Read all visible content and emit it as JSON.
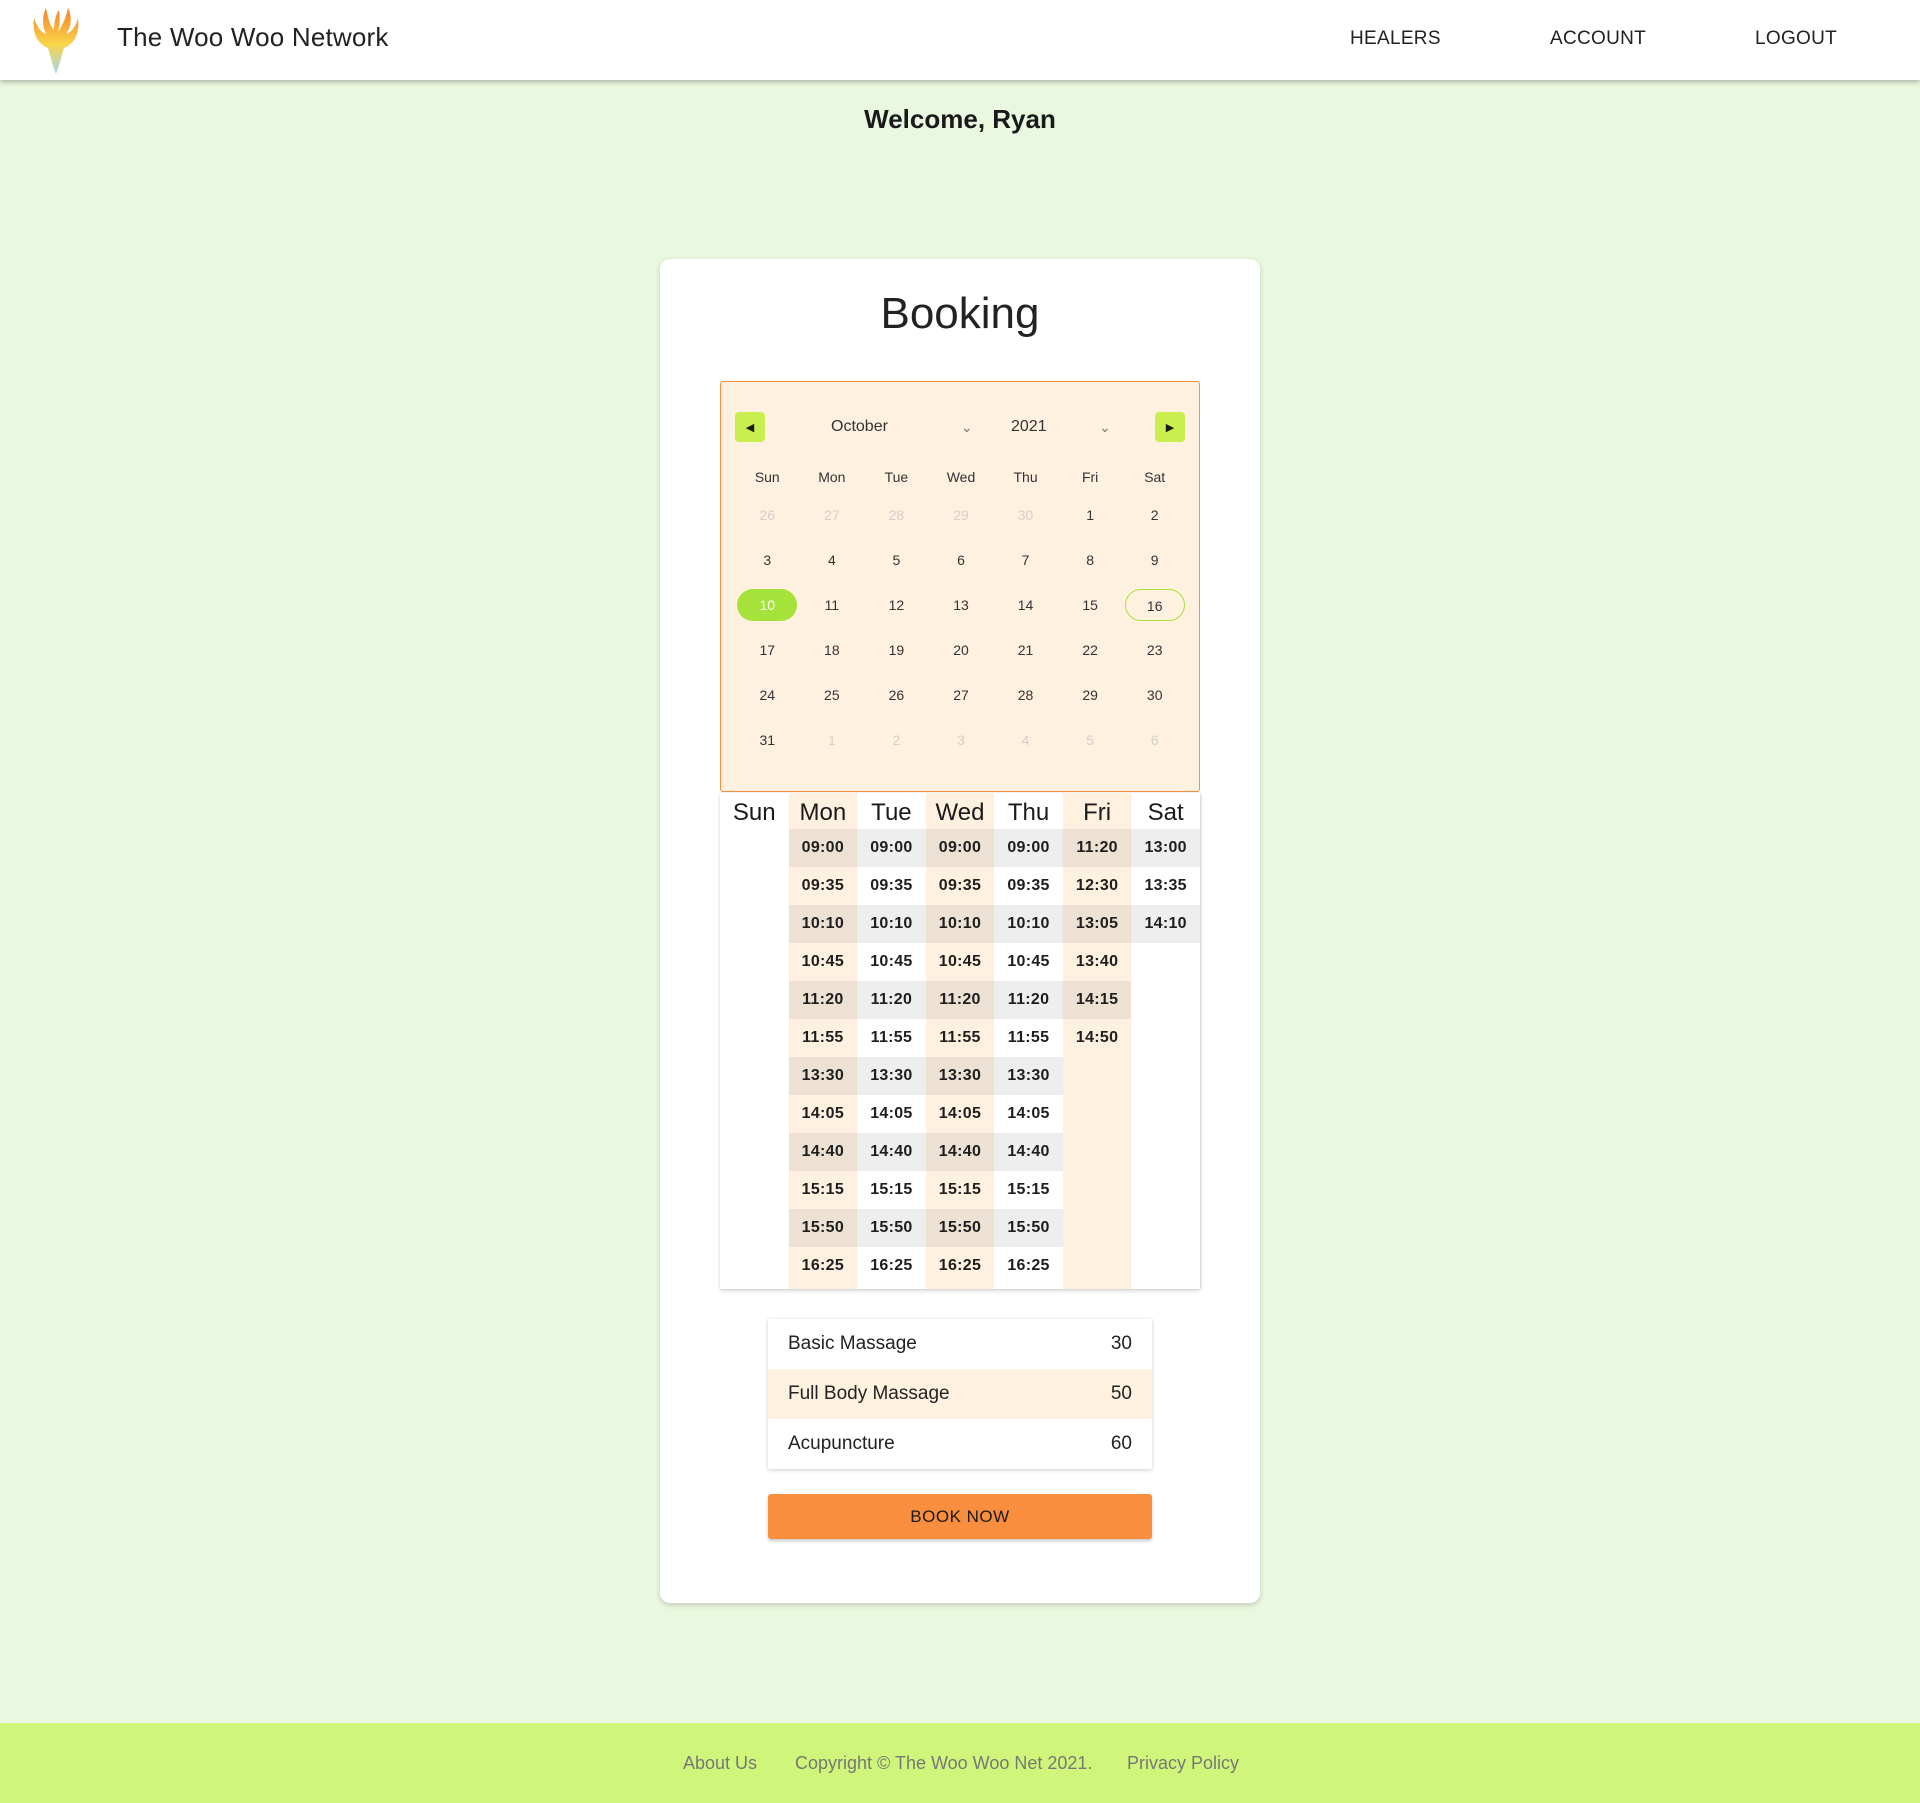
{
  "header": {
    "brand": "The Woo Woo Network",
    "nav": {
      "healers": "HEALERS",
      "account": "ACCOUNT",
      "logout": "LOGOUT"
    }
  },
  "welcome": "Welcome, Ryan",
  "booking": {
    "title": "Booking",
    "calendar": {
      "month": "October",
      "year": "2021",
      "weekdays": [
        "Sun",
        "Mon",
        "Tue",
        "Wed",
        "Thu",
        "Fri",
        "Sat"
      ],
      "selected_day": "10",
      "today_day": "16",
      "days": [
        "26",
        "27",
        "28",
        "29",
        "30",
        "1",
        "2",
        "3",
        "4",
        "5",
        "6",
        "7",
        "8",
        "9",
        "10",
        "11",
        "12",
        "13",
        "14",
        "15",
        "16",
        "17",
        "18",
        "19",
        "20",
        "21",
        "22",
        "23",
        "24",
        "25",
        "26",
        "27",
        "28",
        "29",
        "30",
        "31",
        "1",
        "2",
        "3",
        "4",
        "5",
        "6"
      ],
      "outside_month": [
        0,
        1,
        2,
        3,
        4,
        36,
        37,
        38,
        39,
        40,
        41
      ]
    },
    "schedule": [
      {
        "day": "Sun",
        "slots": []
      },
      {
        "day": "Mon",
        "slots": [
          "09:00",
          "09:35",
          "10:10",
          "10:45",
          "11:20",
          "11:55",
          "13:30",
          "14:05",
          "14:40",
          "15:15",
          "15:50",
          "16:25"
        ]
      },
      {
        "day": "Tue",
        "slots": [
          "09:00",
          "09:35",
          "10:10",
          "10:45",
          "11:20",
          "11:55",
          "13:30",
          "14:05",
          "14:40",
          "15:15",
          "15:50",
          "16:25"
        ]
      },
      {
        "day": "Wed",
        "slots": [
          "09:00",
          "09:35",
          "10:10",
          "10:45",
          "11:20",
          "11:55",
          "13:30",
          "14:05",
          "14:40",
          "15:15",
          "15:50",
          "16:25"
        ]
      },
      {
        "day": "Thu",
        "slots": [
          "09:00",
          "09:35",
          "10:10",
          "10:45",
          "11:20",
          "11:55",
          "13:30",
          "14:05",
          "14:40",
          "15:15",
          "15:50",
          "16:25"
        ]
      },
      {
        "day": "Fri",
        "slots": [
          "11:20",
          "12:30",
          "13:05",
          "13:40",
          "14:15",
          "14:50"
        ]
      },
      {
        "day": "Sat",
        "slots": [
          "13:00",
          "13:35",
          "14:10"
        ]
      }
    ],
    "services": [
      {
        "name": "Basic Massage",
        "price": "30"
      },
      {
        "name": "Full Body Massage",
        "price": "50"
      },
      {
        "name": "Acupuncture",
        "price": "60"
      }
    ],
    "book_label": "BOOK NOW"
  },
  "footer": {
    "about": "About Us",
    "copyright": "Copyright © The Woo Woo Net 2021.",
    "privacy": "Privacy Policy"
  },
  "colors": {
    "page_bg": "#eaf8df",
    "accent_green": "#a5e33a",
    "cream": "#fff1e0",
    "orange": "#f98f3e",
    "footer_bg": "#cff67a"
  }
}
